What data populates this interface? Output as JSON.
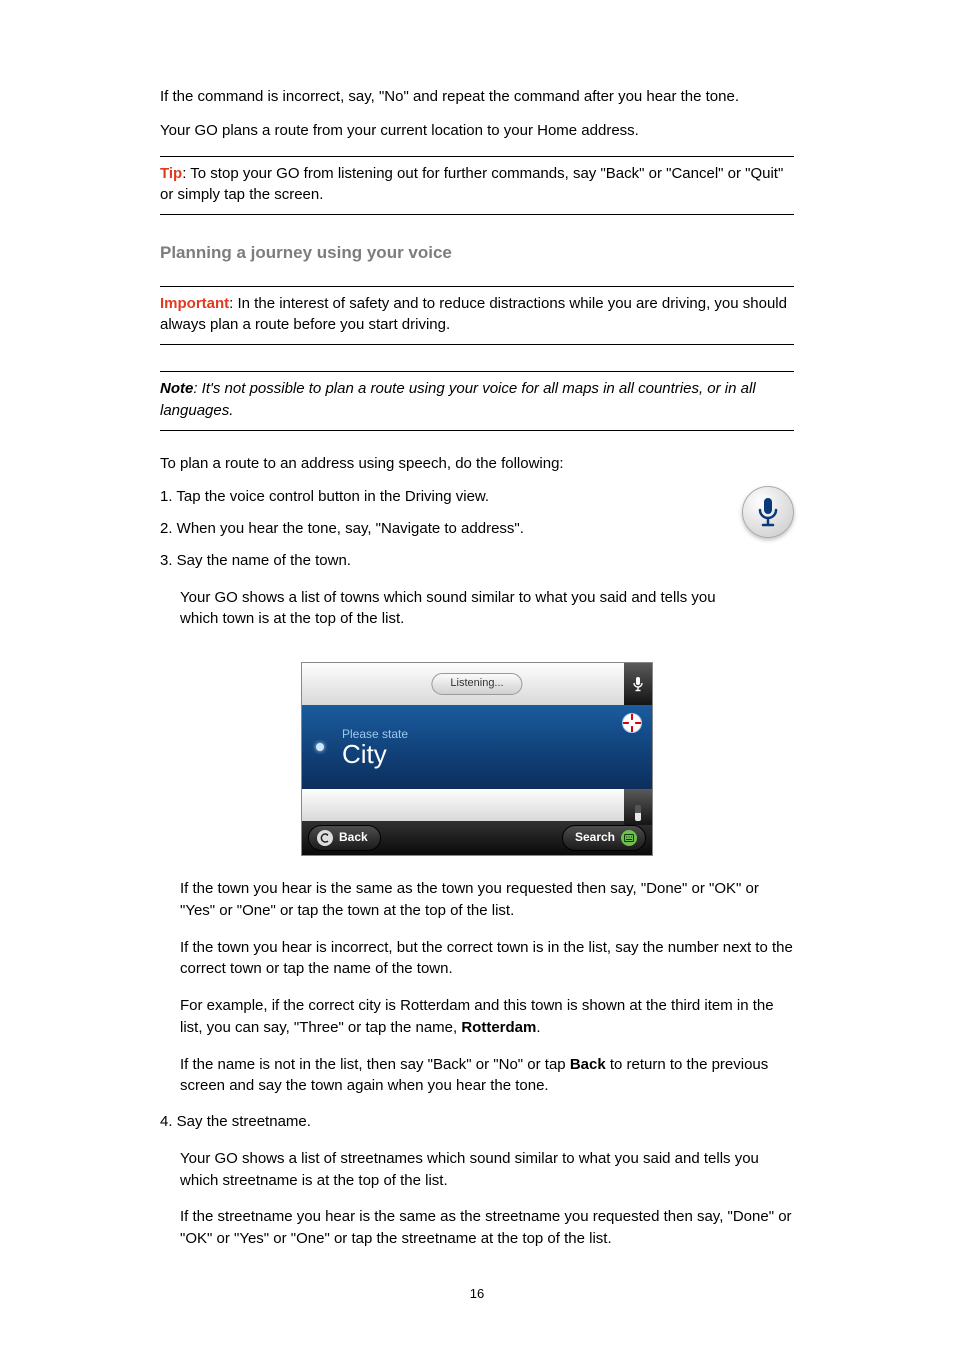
{
  "intro": {
    "para1": "If the command is incorrect, say, \"No\" and repeat the command after you hear the tone.",
    "para2": "Your GO plans a route from your current location to your Home address."
  },
  "tip": {
    "label": "Tip",
    "text": ": To stop your GO from listening out for further commands, say \"Back\" or \"Cancel\" or \"Quit\" or simply tap the screen."
  },
  "heading": "Planning a journey using your voice",
  "important": {
    "label": "Important",
    "text": ": In the interest of safety and to reduce distractions while you are driving, you should always plan a route before you start driving."
  },
  "note": {
    "label": "Note",
    "text": ": It's not possible to plan a route using your voice for all maps in all countries, or in all languages."
  },
  "lead": "To plan a route to an address using speech, do the following:",
  "mic_icon": "microphone-icon",
  "steps": {
    "s1": "1. Tap the voice control button in the Driving view.",
    "s2": "2. When you hear the tone, say, \"Navigate to address\".",
    "s3": "3. Say the name of the town.",
    "s3_body1": "Your GO shows a list of towns which sound similar to what you said and tells you which town is at the top of the list.",
    "s3_body2": "If the town you hear is the same as the town you requested then say, \"Done\" or \"OK\" or \"Yes\" or \"One\" or tap the town at the top of the list.",
    "s3_body3": "If the town you hear is incorrect, but the correct town is in the list, say the number next to the correct town or tap the name of the town.",
    "s3_body4a": "For example, if the correct city is Rotterdam and this town is shown at the third item in the list, you can say, \"Three\" or tap the name, ",
    "s3_body4b": "Rotterdam",
    "s3_body4c": ".",
    "s3_body5a": "If the name is not in the list, then say \"Back\" or \"No\" or tap ",
    "s3_body5b": "Back",
    "s3_body5c": " to return to the previous screen and say the town again when you hear the tone.",
    "s4": "4. Say the streetname.",
    "s4_body1": "Your GO shows a list of streetnames which sound similar to what you said and tells you which streetname is at the top of the list.",
    "s4_body2": "If the streetname you hear is the same as the streetname you requested then say, \"Done\" or \"OK\" or \"Yes\" or \"One\" or tap the streetname at the top of the list."
  },
  "device": {
    "listening": "Listening...",
    "please_state": "Please state",
    "city": "City",
    "back": "Back",
    "search": "Search"
  },
  "page_number": "16"
}
